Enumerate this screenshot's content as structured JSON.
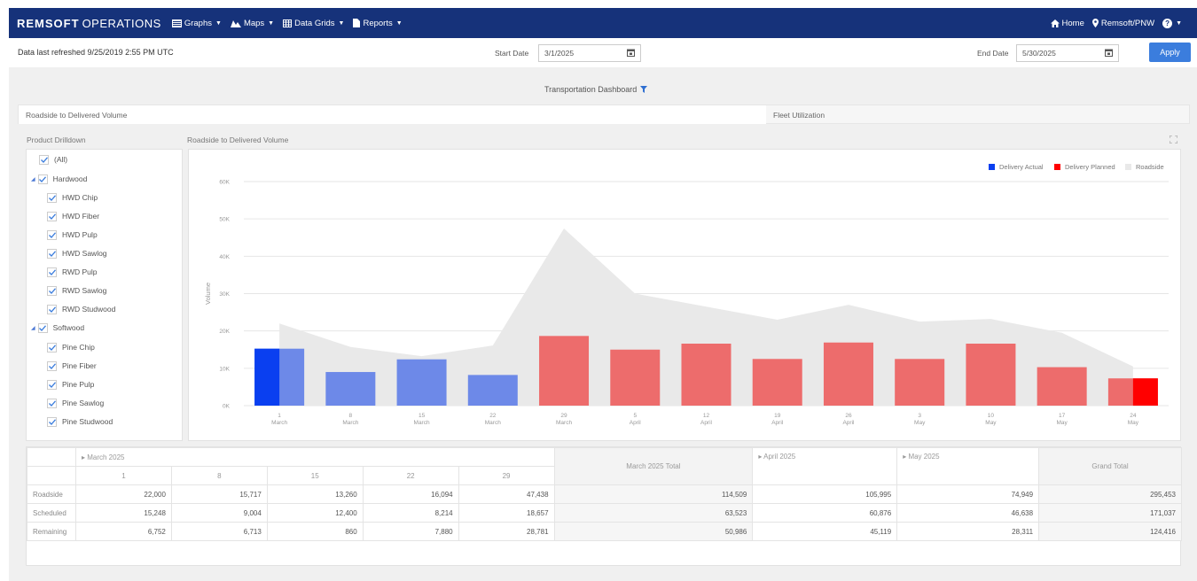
{
  "nav": {
    "brand_bold": "REMSOFT",
    "brand_light": "OPERATIONS",
    "menus": [
      {
        "label": "Graphs",
        "icon": "bar-chart-icon"
      },
      {
        "label": "Maps",
        "icon": "map-icon"
      },
      {
        "label": "Data Grids",
        "icon": "grid-icon"
      },
      {
        "label": "Reports",
        "icon": "document-icon"
      }
    ],
    "home": "Home",
    "location": "Remsoft/PNW",
    "help": "?"
  },
  "filter": {
    "refreshed": "Data last refreshed 9/25/2019 2:55 PM UTC",
    "start_label": "Start Date",
    "start_value": "3/1/2025",
    "end_label": "End Date",
    "end_value": "5/30/2025",
    "apply": "Apply"
  },
  "dashboard": {
    "title": "Transportation Dashboard",
    "tabs": [
      "Roadside to Delivered Volume",
      "Fleet Utilization"
    ],
    "left_panel_title": "Product Drilldown",
    "chart_panel_title": "Roadside to Delivered Volume"
  },
  "tree": {
    "all": "(All)",
    "groups": [
      {
        "label": "Hardwood",
        "items": [
          "HWD Chip",
          "HWD Fiber",
          "HWD Pulp",
          "HWD Sawlog",
          "RWD Pulp",
          "RWD Sawlog",
          "RWD Studwood"
        ]
      },
      {
        "label": "Softwood",
        "items": [
          "Pine Chip",
          "Pine Fiber",
          "Pine Pulp",
          "Pine Sawlog",
          "Pine Studwood"
        ]
      }
    ]
  },
  "colors": {
    "delivery_actual": "#0a3ff0",
    "delivery_planned": "#ff0000",
    "roadside": "#e9e9e9",
    "actual_light": "#6d89e8",
    "planned_light": "#ed6c6c",
    "nav_bg": "#16327a",
    "apply": "#3b7ddd"
  },
  "chart_data": {
    "type": "bar",
    "ylabel": "Volume",
    "ylim": [
      0,
      60000
    ],
    "yticks": [
      "0K",
      "10K",
      "20K",
      "30K",
      "40K",
      "50K",
      "60K"
    ],
    "legend": [
      "Delivery Actual",
      "Delivery Planned",
      "Roadside"
    ],
    "legend_position": "top-right",
    "categories": [
      {
        "day": "1",
        "month": "March"
      },
      {
        "day": "8",
        "month": "March"
      },
      {
        "day": "15",
        "month": "March"
      },
      {
        "day": "22",
        "month": "March"
      },
      {
        "day": "29",
        "month": "March"
      },
      {
        "day": "5",
        "month": "April"
      },
      {
        "day": "12",
        "month": "April"
      },
      {
        "day": "19",
        "month": "April"
      },
      {
        "day": "26",
        "month": "April"
      },
      {
        "day": "3",
        "month": "May"
      },
      {
        "day": "10",
        "month": "May"
      },
      {
        "day": "17",
        "month": "May"
      },
      {
        "day": "24",
        "month": "May"
      }
    ],
    "series": [
      {
        "name": "Roadside",
        "type": "area",
        "values": [
          22000,
          15717,
          13260,
          16094,
          47438,
          30000,
          26500,
          23000,
          27000,
          22500,
          23200,
          19500,
          10500
        ]
      },
      {
        "name": "Delivery Scheduled",
        "type": "bar",
        "values": [
          15248,
          9004,
          12400,
          8214,
          18657,
          15000,
          16600,
          12500,
          16900,
          12500,
          16600,
          10300,
          7300
        ]
      },
      {
        "name": "Delivery Actual",
        "type": "highlight",
        "index": 0,
        "value": 15248
      },
      {
        "name": "Delivery Planned",
        "type": "highlight",
        "index": 12,
        "value": 7300
      }
    ],
    "actual_count": 4
  },
  "grid": {
    "month_headers": [
      "March 2025",
      "April 2025",
      "May 2025"
    ],
    "march_days": [
      "1",
      "8",
      "15",
      "22",
      "29"
    ],
    "march_total_label": "March 2025 Total",
    "grand_total_label": "Grand Total",
    "rows": [
      {
        "label": "Roadside",
        "march": [
          "22,000",
          "15,717",
          "13,260",
          "16,094",
          "47,438"
        ],
        "march_total": "114,509",
        "april": "105,995",
        "may": "74,949",
        "grand": "295,453"
      },
      {
        "label": "Scheduled",
        "march": [
          "15,248",
          "9,004",
          "12,400",
          "8,214",
          "18,657"
        ],
        "march_total": "63,523",
        "april": "60,876",
        "may": "46,638",
        "grand": "171,037"
      },
      {
        "label": "Remaining",
        "march": [
          "6,752",
          "6,713",
          "860",
          "7,880",
          "28,781"
        ],
        "march_total": "50,986",
        "april": "45,119",
        "may": "28,311",
        "grand": "124,416"
      }
    ]
  }
}
